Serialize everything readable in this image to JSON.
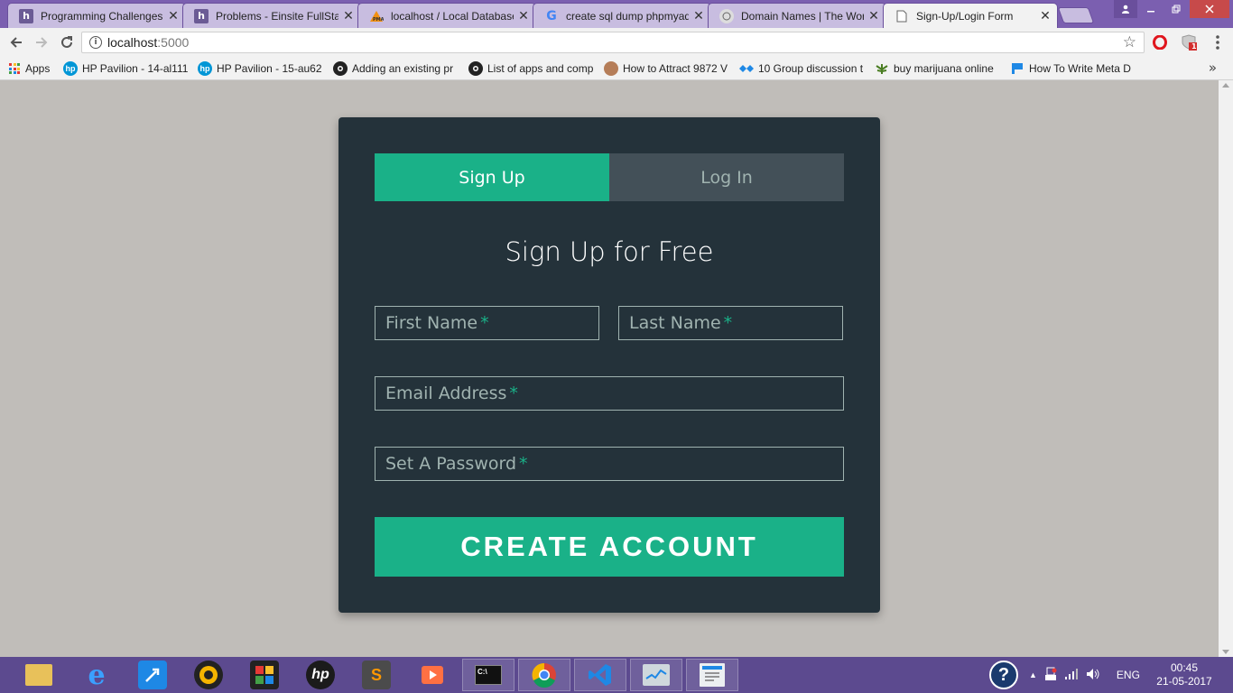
{
  "browser": {
    "tabs": [
      {
        "title": "Programming Challenges",
        "favicon": "h",
        "favicon_color": "#6b5b95"
      },
      {
        "title": "Problems - Einsite FullStack",
        "favicon": "h",
        "favicon_color": "#6b5b95"
      },
      {
        "title": "localhost / Local Database",
        "favicon": "pma",
        "favicon_color": "#f29111"
      },
      {
        "title": "create sql dump phpmyadmin",
        "favicon": "G",
        "favicon_color": "#4285f4"
      },
      {
        "title": "Domain Names | The World",
        "favicon": "dn",
        "favicon_color": "#888888"
      },
      {
        "title": "Sign-Up/Login Form",
        "favicon": "doc",
        "favicon_color": "#ffffff"
      }
    ],
    "close_glyph": "✕",
    "address": {
      "host": "localhost",
      "port": ":5000"
    },
    "bookmarks": [
      {
        "label": "Apps",
        "icon": "apps-grid-icon"
      },
      {
        "label": "HP Pavilion - 14-al111",
        "icon": "hp-icon"
      },
      {
        "label": "HP Pavilion - 15-au62",
        "icon": "hp-icon"
      },
      {
        "label": "Adding an existing pr",
        "icon": "github-icon"
      },
      {
        "label": "List of apps and comp",
        "icon": "github-icon"
      },
      {
        "label": "How to Attract 9872 V",
        "icon": "avatar-icon"
      },
      {
        "label": "10 Group discussion t",
        "icon": "diamond-icon"
      },
      {
        "label": "buy marijuana online",
        "icon": "leaf-icon"
      },
      {
        "label": "How To Write Meta D",
        "icon": "flag-icon"
      }
    ],
    "more_bookmarks": "»",
    "opera_badge": "1"
  },
  "form": {
    "tabs": {
      "signup": "Sign Up",
      "login": "Log In"
    },
    "heading": "Sign Up for Free",
    "fields": {
      "first_name": "First Name",
      "last_name": "Last Name",
      "email": "Email Address",
      "password": "Set A Password"
    },
    "required_mark": "*",
    "submit": "CREATE ACCOUNT",
    "colors": {
      "accent": "#1ab188",
      "card": "#24323a",
      "inactive_tab": "#435058",
      "muted_text": "#a0b3b0",
      "page_bg": "#c0bdb9"
    }
  },
  "taskbar": {
    "apps": [
      "file-explorer-icon",
      "internet-explorer-icon",
      "rocket-app-icon",
      "media-player-icon",
      "puzzle-app-icon",
      "hp-app-icon",
      "sublime-text-icon",
      "video-player-icon",
      "command-prompt-icon",
      "chrome-icon",
      "visual-studio-icon",
      "task-manager-icon",
      "notepad-icon"
    ],
    "language": "ENG",
    "time": "00:45",
    "date": "21-05-2017"
  }
}
